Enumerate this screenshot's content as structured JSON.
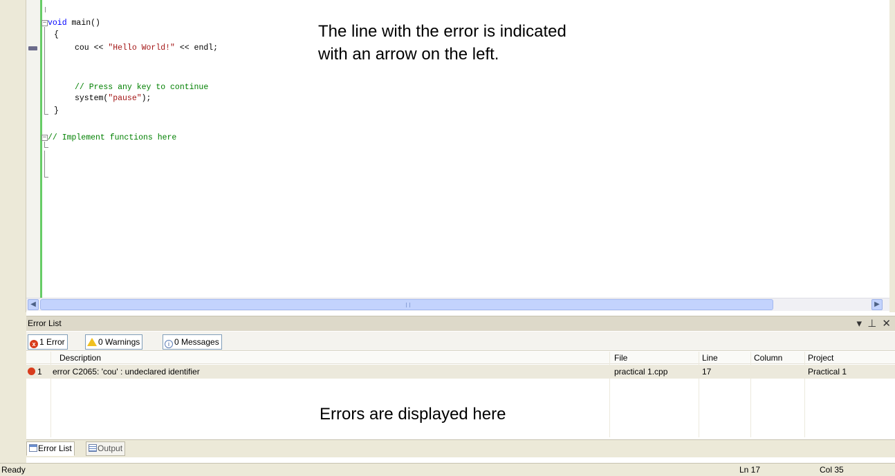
{
  "editor": {
    "code": {
      "main_void": "void",
      "main_rest": " main()",
      "open_brace": "{",
      "cout_a": "cou << ",
      "cout_str": "\"Hello World!\"",
      "cout_b": " << endl;",
      "comment_press": "// Press any key to continue",
      "system_a": "system(",
      "system_str": "\"pause\"",
      "system_b": ");",
      "close_brace": "}",
      "comment_impl": "// Implement functions here"
    }
  },
  "annotations": {
    "arrow_line1": "The line with the error is indicated",
    "arrow_line2": "with an arrow on the left.",
    "errors_here": "Errors are displayed here"
  },
  "error_panel": {
    "title": "Error List",
    "controls": "▾ ⊥ ✕",
    "filters": {
      "errors": "1 Error",
      "warnings": "0 Warnings",
      "messages": "0 Messages"
    },
    "columns": {
      "description": "Description",
      "file": "File",
      "line": "Line",
      "column": "Column",
      "project": "Project"
    },
    "rows": [
      {
        "index": "1",
        "description": "error C2065: 'cou' : undeclared identifier",
        "file": "practical 1.cpp",
        "line": "17",
        "column": "",
        "project": "Practical 1",
        "icon": "error-icon"
      }
    ]
  },
  "bottom_tabs": {
    "error_list": "Error List",
    "output": "Output"
  },
  "status_bar": {
    "state": "Ready",
    "line": "Ln 17",
    "column": "Col 35"
  },
  "colors": {
    "keyword": "#0000ff",
    "string": "#a31515",
    "comment": "#008000",
    "error_icon": "#d83c1c",
    "change_bar": "#66cc66"
  }
}
